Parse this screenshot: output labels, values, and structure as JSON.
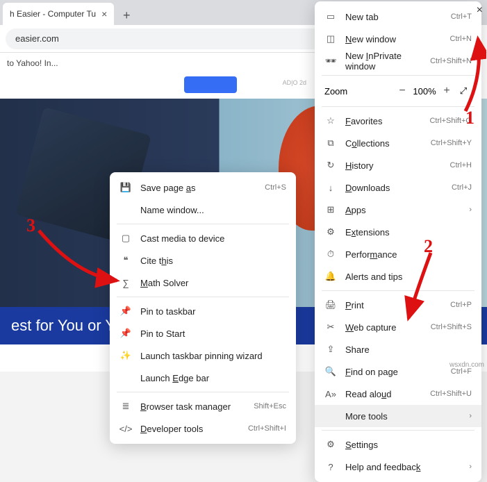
{
  "tab": {
    "title": "h Easier - Computer Tu"
  },
  "addr": {
    "url": "easier.com",
    "star_icon": "star"
  },
  "bookmarks": {
    "item1": "to Yahoo! In..."
  },
  "page": {
    "caption": "est for You or Your",
    "ad_label": "AD|O 2d"
  },
  "annotations": {
    "n1": "1",
    "n2": "2",
    "n3": "3"
  },
  "watermark": "wsxdn.com",
  "main_menu": {
    "new_tab": {
      "label": "New tab",
      "short": "Ctrl+T"
    },
    "new_window": {
      "label_pre": "",
      "label_u": "N",
      "label_post": "ew window",
      "short": "Ctrl+N"
    },
    "inprivate": {
      "label_pre": "New ",
      "label_u": "I",
      "label_post": "nPrivate window",
      "short": "Ctrl+Shift+N"
    },
    "zoom": {
      "label": "Zoom",
      "value": "100%"
    },
    "favorites": {
      "label_u": "F",
      "label_post": "avorites",
      "short": "Ctrl+Shift+O"
    },
    "collections": {
      "label_pre": "C",
      "label_u": "o",
      "label_post": "llections",
      "short": "Ctrl+Shift+Y"
    },
    "history": {
      "label_u": "H",
      "label_post": "istory",
      "short": "Ctrl+H"
    },
    "downloads": {
      "label_u": "D",
      "label_post": "ownloads",
      "short": "Ctrl+J"
    },
    "apps": {
      "label_u": "A",
      "label_post": "pps"
    },
    "extensions": {
      "label_pre": "E",
      "label_u": "x",
      "label_post": "tensions"
    },
    "performance": {
      "label_pre": "Perfor",
      "label_u": "m",
      "label_post": "ance"
    },
    "alerts": {
      "label": "Alerts and tips"
    },
    "print": {
      "label_u": "P",
      "label_post": "rint",
      "short": "Ctrl+P"
    },
    "web_capture": {
      "label_u": "W",
      "label_post": "eb capture",
      "short": "Ctrl+Shift+S"
    },
    "share": {
      "label": "Share"
    },
    "find": {
      "label_u": "F",
      "label_post": "ind on page",
      "short": "Ctrl+F"
    },
    "read_aloud": {
      "label_pre": "Read alo",
      "label_u": "u",
      "label_post": "d",
      "short": "Ctrl+Shift+U"
    },
    "more_tools": {
      "label": "More tools"
    },
    "settings": {
      "label_u": "S",
      "label_post": "ettings"
    },
    "help": {
      "label_pre": "Help and feedbac",
      "label_u": "k"
    }
  },
  "sub_menu": {
    "save_page": {
      "label_pre": "Save page ",
      "label_u": "a",
      "label_post": "s",
      "short": "Ctrl+S"
    },
    "name_window": {
      "label": "Name window..."
    },
    "cast": {
      "label": "Cast media to device"
    },
    "cite_this": {
      "label_pre": "Cite t",
      "label_u": "h",
      "label_post": "is"
    },
    "math_solver": {
      "label_pre": "",
      "label_u": "M",
      "label_post": "ath Solver"
    },
    "pin_taskbar": {
      "label": "Pin to taskbar"
    },
    "pin_start": {
      "label": "Pin to Start"
    },
    "launch_pinning": {
      "label": "Launch taskbar pinning wizard"
    },
    "launch_edge_bar": {
      "label_pre": "Launch ",
      "label_u": "E",
      "label_post": "dge bar"
    },
    "task_manager": {
      "label_pre": "",
      "label_u": "B",
      "label_post": "rowser task manager",
      "short": "Shift+Esc"
    },
    "dev_tools": {
      "label_pre": "",
      "label_u": "D",
      "label_post": "eveloper tools",
      "short": "Ctrl+Shift+I"
    }
  }
}
